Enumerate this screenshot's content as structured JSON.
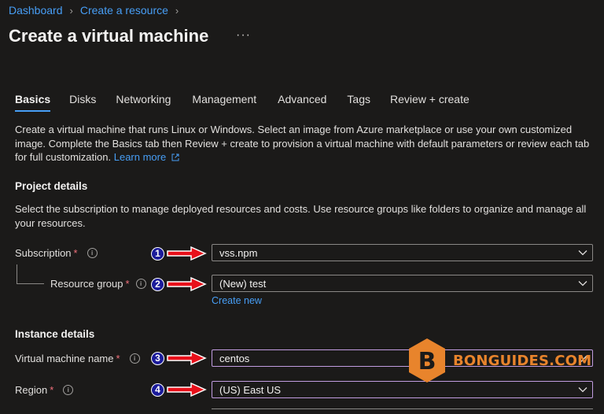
{
  "breadcrumb": {
    "dashboard": "Dashboard",
    "create_resource": "Create a resource"
  },
  "page": {
    "title": "Create a virtual machine",
    "more": "···"
  },
  "tabs": [
    "Basics",
    "Disks",
    "Networking",
    "Management",
    "Advanced",
    "Tags",
    "Review + create"
  ],
  "intro": {
    "text": "Create a virtual machine that runs Linux or Windows. Select an image from Azure marketplace or use your own customized image. Complete the Basics tab then Review + create to provision a virtual machine with default parameters or review each tab for full customization.",
    "learn_more": "Learn more"
  },
  "project": {
    "heading": "Project details",
    "description": "Select the subscription to manage deployed resources and costs. Use resource groups like folders to organize and manage all your resources.",
    "subscription_label": "Subscription",
    "subscription_value": "vss.npm",
    "resource_group_label": "Resource group",
    "resource_group_value": "(New) test",
    "create_new": "Create new"
  },
  "instance": {
    "heading": "Instance details",
    "vm_name_label": "Virtual machine name",
    "vm_name_value": "centos",
    "region_label": "Region",
    "region_value": "(US) East US"
  },
  "required_mark": "*",
  "info_glyph": "i",
  "annotations": [
    "1",
    "2",
    "3",
    "4"
  ],
  "watermark": {
    "logo_letter": "B",
    "text": "BONGUIDES.COM"
  },
  "colors": {
    "background": "#1b1a19",
    "link": "#479ef5",
    "required": "#f1707b",
    "arrow": "#e8101a",
    "focus_border": "#c19ce0",
    "watermark": "#e8842c",
    "badge": "#1b1b9a"
  }
}
